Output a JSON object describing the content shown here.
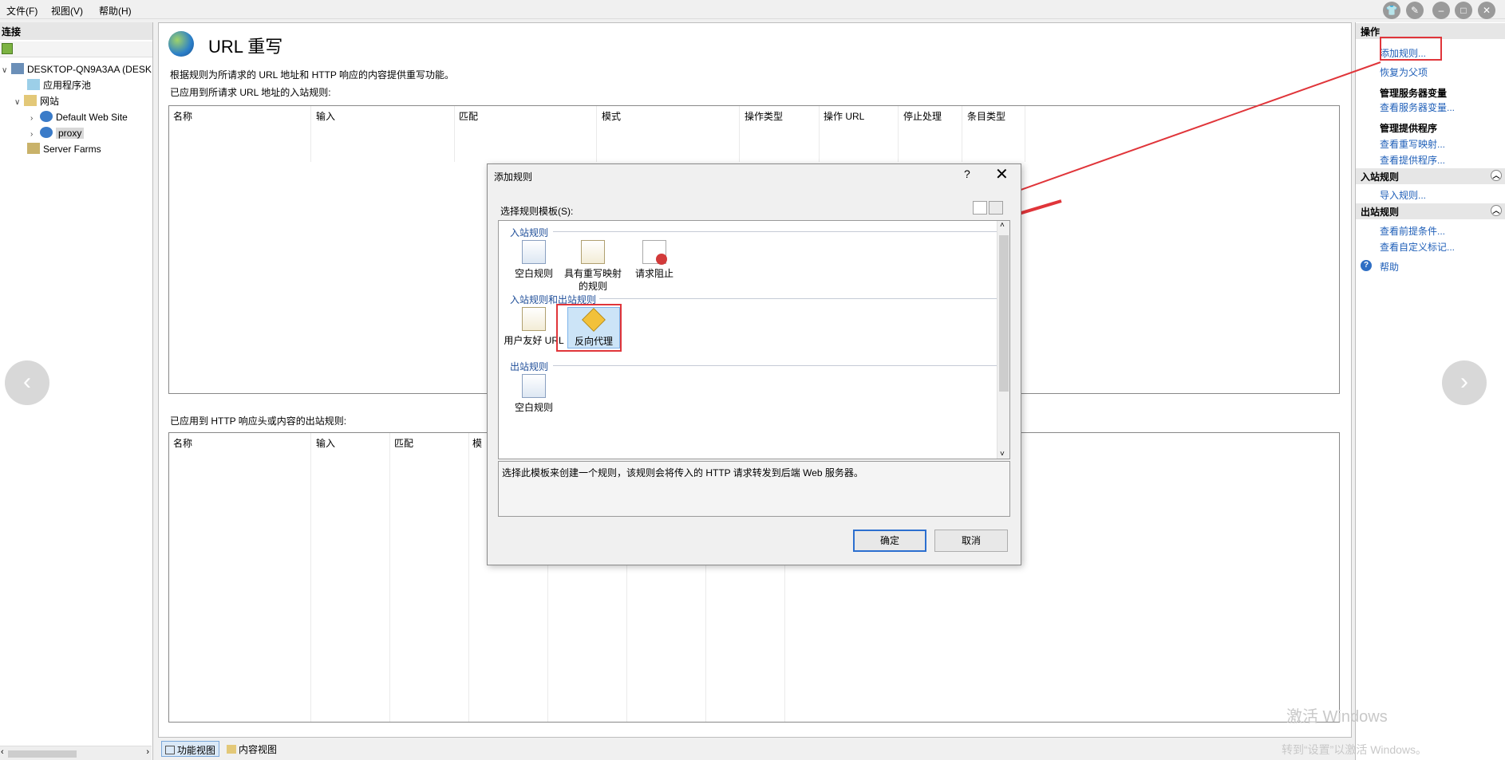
{
  "menubar": {
    "items": [
      "文件(F)",
      "视图(V)",
      "帮助(H)"
    ]
  },
  "connections": {
    "title": "连接",
    "tree": [
      {
        "label": "DESKTOP-QN9A3AA (DESK",
        "level": 0
      },
      {
        "label": "应用程序池",
        "level": 1
      },
      {
        "label": "网站",
        "level": 1
      },
      {
        "label": "Default Web Site",
        "level": 2
      },
      {
        "label": "proxy",
        "level": 2
      },
      {
        "label": "Server Farms",
        "level": 1
      }
    ]
  },
  "main": {
    "title": "URL 重写",
    "description": "根据规则为所请求的 URL 地址和 HTTP 响应的内容提供重写功能。",
    "inbound_label": "已应用到所请求 URL 地址的入站规则:",
    "inbound_columns": [
      "名称",
      "输入",
      "匹配",
      "模式",
      "操作类型",
      "操作 URL",
      "停止处理",
      "条目类型"
    ],
    "outbound_label": "已应用到 HTTP 响应头或内容的出站规则:",
    "outbound_columns": [
      "名称",
      "输入",
      "匹配",
      "模"
    ],
    "bottom_tabs": [
      "功能视图",
      "内容视图"
    ]
  },
  "actions": {
    "title": "操作",
    "add_rule": "添加规则...",
    "revert": "恢复为父项",
    "server_vars_heading": "管理服务器变量",
    "server_vars_link": "查看服务器变量...",
    "providers_heading": "管理提供程序",
    "rewrite_maps_link": "查看重写映射...",
    "providers_link": "查看提供程序...",
    "inbound_heading": "入站规则",
    "import_rules": "导入规则...",
    "outbound_heading": "出站规则",
    "preconditions_link": "查看前提条件...",
    "custom_tags_link": "查看自定义标记...",
    "help": "帮助"
  },
  "dialog": {
    "title": "添加规则",
    "help_mark": "?",
    "close": "✕",
    "choose_label": "选择规则模板(S):",
    "groups": {
      "inbound": "入站规则",
      "both": "入站规则和出站规则",
      "outbound": "出站规则"
    },
    "templates_inbound": [
      "空白规则",
      "具有重写映射的规则",
      "请求阻止"
    ],
    "templates_both": [
      "用户友好 URL",
      "反向代理"
    ],
    "templates_outbound": [
      "空白规则"
    ],
    "description": "选择此模板来创建一个规则，该规则会将传入的 HTTP 请求转发到后端 Web 服务器。",
    "ok": "确定",
    "cancel": "取消"
  },
  "watermark": {
    "line1": "激活 Windows",
    "line2": "转到“设置”以激活 Windows。"
  },
  "colors": {
    "annotation_red": "#e0353a",
    "link_blue": "#1f5fb8",
    "selection_blue": "#cce4f7"
  }
}
